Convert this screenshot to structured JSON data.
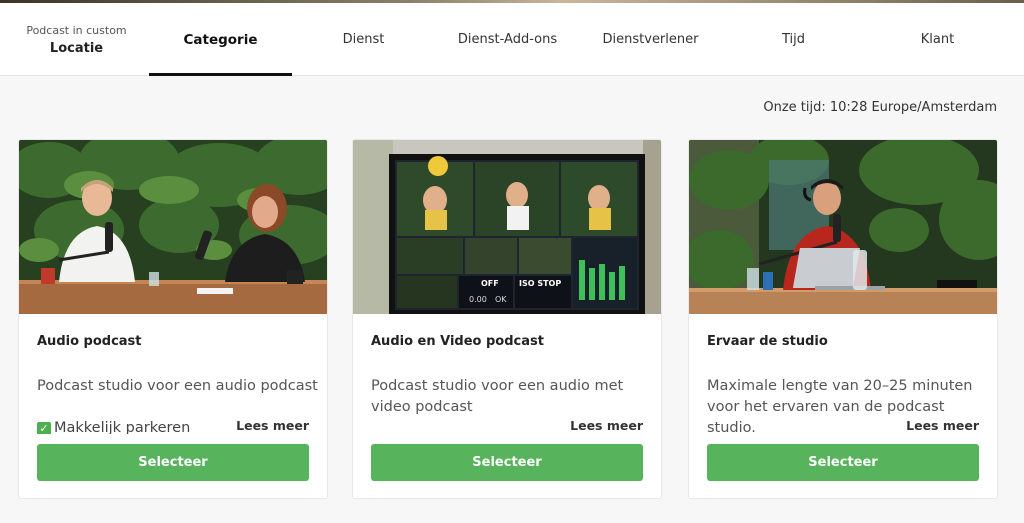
{
  "steps": [
    {
      "sub": "Podcast in custom",
      "label": "Locatie"
    },
    {
      "label": "Categorie"
    },
    {
      "label": "Dienst"
    },
    {
      "label": "Dienst-Add-ons"
    },
    {
      "label": "Dienstverlener"
    },
    {
      "label": "Tijd"
    },
    {
      "label": "Klant"
    }
  ],
  "timezone_text": "Onze tijd: 10:28 Europe/Amsterdam",
  "cards": [
    {
      "title": "Audio podcast",
      "description": "Podcast studio voor een audio podcast",
      "extra": "Makkelijk parkeren",
      "more": "Lees meer",
      "button": "Selecteer"
    },
    {
      "title": "Audio en Video podcast",
      "description": "Podcast studio voor een audio met video podcast",
      "more": "Lees meer",
      "button": "Selecteer"
    },
    {
      "title": "Ervaar de studio",
      "description": "Maximale lengte van 20–25 minuten voor het ervaren van de podcast studio.",
      "more": "Lees meer",
      "button": "Selecteer"
    }
  ],
  "monitor": {
    "off_label": "OFF",
    "iso_label": "ISO STOP",
    "time": "0.00",
    "ok": "OK"
  },
  "colors": {
    "accent": "#57b45c",
    "active_underline": "#111111"
  }
}
